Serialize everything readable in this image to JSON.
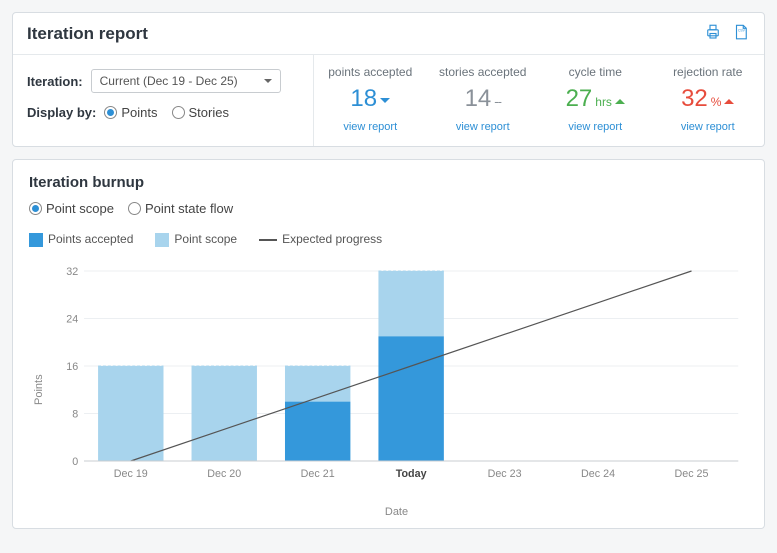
{
  "header": {
    "title": "Iteration report"
  },
  "controls": {
    "iteration_label": "Iteration:",
    "iteration_selected": "Current (Dec 19 - Dec 25)",
    "display_by_label": "Display by:",
    "display_by_options": {
      "points": "Points",
      "stories": "Stories"
    },
    "display_by_selected": "points"
  },
  "metrics": {
    "points_accepted": {
      "label": "points accepted",
      "value": "18",
      "trend": "down",
      "color": "blue",
      "link": "view report"
    },
    "stories_accepted": {
      "label": "stories accepted",
      "value": "14",
      "trend": "flat",
      "color": "gray",
      "link": "view report"
    },
    "cycle_time": {
      "label": "cycle time",
      "value": "27",
      "unit": "hrs",
      "trend": "up",
      "color": "green",
      "link": "view report"
    },
    "rejection_rate": {
      "label": "rejection rate",
      "value": "32",
      "unit": "%",
      "trend": "up",
      "color": "red",
      "link": "view report"
    }
  },
  "burnup": {
    "title": "Iteration burnup",
    "view_options": {
      "scope": "Point scope",
      "flow": "Point state flow"
    },
    "view_selected": "scope",
    "legend": {
      "accepted": "Points accepted",
      "scope": "Point scope",
      "expected": "Expected progress"
    },
    "ylabel": "Points",
    "xlabel": "Date"
  },
  "chart_data": {
    "type": "bar",
    "xlabel": "Date",
    "ylabel": "Points",
    "ylim": [
      0,
      32
    ],
    "yticks": [
      0,
      8,
      16,
      24,
      32
    ],
    "categories": [
      "Dec 19",
      "Dec 20",
      "Dec 21",
      "Today",
      "Dec 23",
      "Dec 24",
      "Dec 25"
    ],
    "series": [
      {
        "name": "Points accepted",
        "values": [
          0,
          0,
          10,
          21,
          null,
          null,
          null
        ],
        "color": "#3498db"
      },
      {
        "name": "Point scope",
        "values": [
          16,
          16,
          16,
          32,
          null,
          null,
          null
        ],
        "color": "#a8d4ed"
      },
      {
        "name": "Expected progress",
        "type": "line",
        "values": [
          0,
          5.33,
          10.67,
          16,
          21.33,
          26.67,
          32
        ],
        "color": "#555"
      }
    ],
    "legend_position": "top",
    "grid": true
  }
}
